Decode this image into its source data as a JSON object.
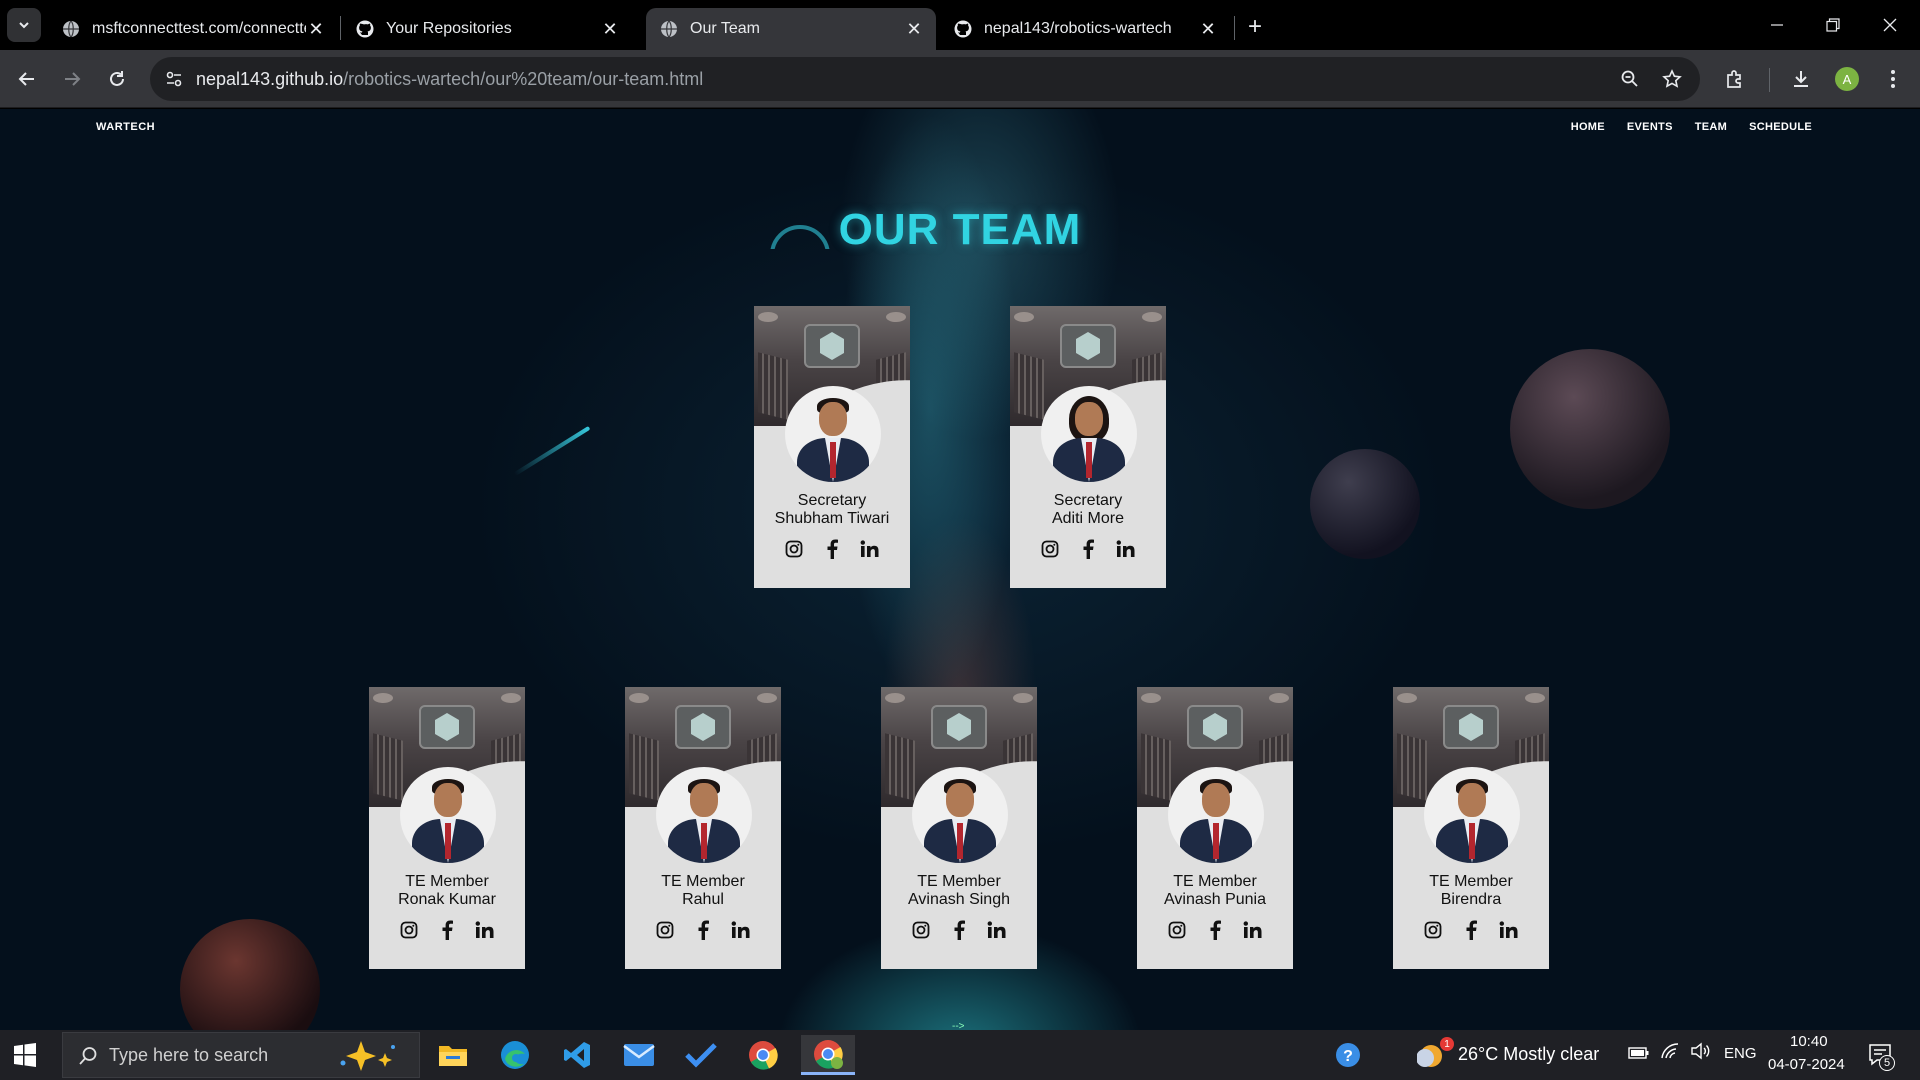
{
  "browser": {
    "tabs": [
      {
        "title": "msftconnecttest.com/connectte",
        "icon": "globe-icon",
        "active": false
      },
      {
        "title": "Your Repositories",
        "icon": "github-icon",
        "active": false
      },
      {
        "title": "Our Team",
        "icon": "globe-icon",
        "active": true
      },
      {
        "title": "nepal143/robotics-wartech",
        "icon": "github-icon",
        "active": false
      }
    ],
    "url_host": "nepal143.github.io",
    "url_path": "/robotics-wartech/our%20team/our-team.html",
    "profile_initial": "A"
  },
  "site": {
    "logo": "WARTECH",
    "nav": [
      "HOME",
      "EVENTS",
      "TEAM",
      "SCHEDULE"
    ],
    "title": "OUR TEAM",
    "arrow_hint": "-->"
  },
  "team": {
    "secretaries": [
      {
        "role": "Secretary",
        "name": "Shubham Tiwari",
        "gender": "male"
      },
      {
        "role": "Secretary",
        "name": "Aditi More",
        "gender": "female"
      }
    ],
    "members": [
      {
        "role": "TE Member",
        "name": "Ronak Kumar",
        "gender": "male"
      },
      {
        "role": "TE Member",
        "name": "Rahul",
        "gender": "male"
      },
      {
        "role": "TE Member",
        "name": "Avinash Singh",
        "gender": "male"
      },
      {
        "role": "TE Member",
        "name": "Avinash Punia",
        "gender": "male"
      },
      {
        "role": "TE Member",
        "name": "Birendra",
        "gender": "male"
      }
    ],
    "social_icons": [
      "instagram-icon",
      "facebook-icon",
      "linkedin-icon"
    ]
  },
  "taskbar": {
    "search_placeholder": "Type here to search",
    "weather": "26°C  Mostly clear",
    "language": "ENG",
    "time": "10:40",
    "date": "04-07-2024",
    "notification_count": "5",
    "weather_badge": "1"
  }
}
